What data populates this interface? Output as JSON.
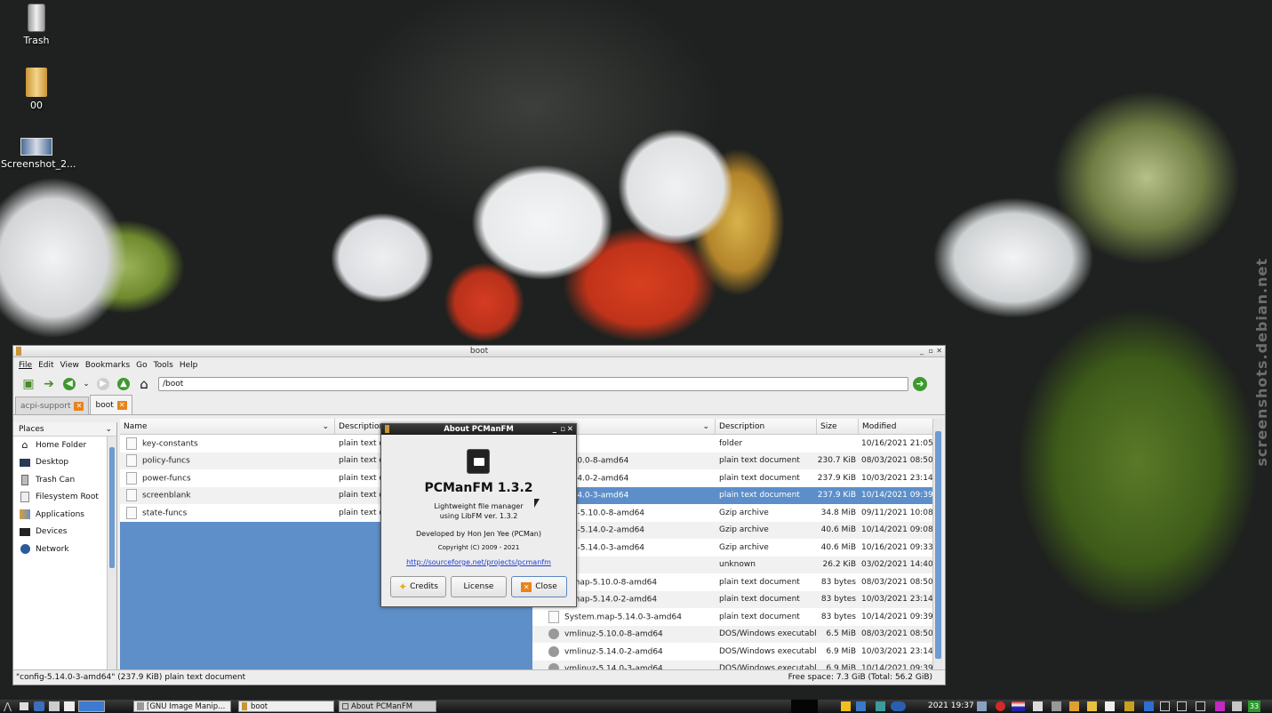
{
  "desktop": {
    "icons": [
      {
        "label": "Trash"
      },
      {
        "label": "00"
      },
      {
        "label": "Screenshot_2..."
      }
    ],
    "watermark": "screenshots.debian.net"
  },
  "window": {
    "title": "boot",
    "menu": [
      "File",
      "Edit",
      "View",
      "Bookmarks",
      "Go",
      "Tools",
      "Help"
    ],
    "path": "/boot",
    "tabs": [
      {
        "label": "acpi-support"
      },
      {
        "label": "boot"
      }
    ],
    "places": {
      "header": "Places",
      "items": [
        "Home Folder",
        "Desktop",
        "Trash Can",
        "Filesystem Root",
        "Applications",
        "Devices",
        "Network"
      ]
    },
    "left_pane": {
      "columns": [
        "Name",
        "Description"
      ],
      "rows": [
        {
          "name": "key-constants",
          "desc": "plain text d"
        },
        {
          "name": "policy-funcs",
          "desc": "plain text d"
        },
        {
          "name": "power-funcs",
          "desc": "plain text d"
        },
        {
          "name": "screenblank",
          "desc": "plain text d"
        },
        {
          "name": "state-funcs",
          "desc": "plain text d"
        }
      ]
    },
    "right_pane": {
      "columns": [
        "Description",
        "Size",
        "Modified"
      ],
      "rows": [
        {
          "name": "",
          "desc": "folder",
          "size": "",
          "mod": "10/16/2021 21:05"
        },
        {
          "name": "5.10.0-8-amd64",
          "desc": "plain text document",
          "size": "230.7 KiB",
          "mod": "08/03/2021 08:50"
        },
        {
          "name": "5.14.0-2-amd64",
          "desc": "plain text document",
          "size": "237.9 KiB",
          "mod": "10/03/2021 23:14"
        },
        {
          "name": "5.14.0-3-amd64",
          "desc": "plain text document",
          "size": "237.9 KiB",
          "mod": "10/14/2021 09:39"
        },
        {
          "name": "mg-5.10.0-8-amd64",
          "desc": "Gzip archive",
          "size": "34.8 MiB",
          "mod": "09/11/2021 10:08"
        },
        {
          "name": "mg-5.14.0-2-amd64",
          "desc": "Gzip archive",
          "size": "40.6 MiB",
          "mod": "10/14/2021 09:08"
        },
        {
          "name": "mg-5.14.0-3-amd64",
          "desc": "Gzip archive",
          "size": "40.6 MiB",
          "mod": "10/16/2021 09:33"
        },
        {
          "name": "isk",
          "desc": "unknown",
          "size": "26.2 KiB",
          "mod": "03/02/2021 14:40"
        },
        {
          "name": "n.map-5.10.0-8-amd64",
          "desc": "plain text document",
          "size": "83 bytes",
          "mod": "08/03/2021 08:50"
        },
        {
          "name": "n.map-5.14.0-2-amd64",
          "desc": "plain text document",
          "size": "83 bytes",
          "mod": "10/03/2021 23:14"
        },
        {
          "name": "System.map-5.14.0-3-amd64",
          "desc": "plain text document",
          "size": "83 bytes",
          "mod": "10/14/2021 09:39"
        },
        {
          "name": "vmlinuz-5.10.0-8-amd64",
          "desc": "DOS/Windows executable",
          "size": "6.5 MiB",
          "mod": "08/03/2021 08:50"
        },
        {
          "name": "vmlinuz-5.14.0-2-amd64",
          "desc": "DOS/Windows executable",
          "size": "6.9 MiB",
          "mod": "10/03/2021 23:14"
        },
        {
          "name": "vmlinuz-5.14.0-3-amd64",
          "desc": "DOS/Windows executable",
          "size": "6.9 MiB",
          "mod": "10/14/2021 09:39"
        }
      ]
    },
    "status_left": "\"config-5.14.0-3-amd64\" (237.9 KiB) plain text document",
    "status_right": "Free space: 7.3 GiB (Total: 56.2 GiB)"
  },
  "about": {
    "title": "About PCManFM",
    "app_name": "PCManFM 1.3.2",
    "desc_line1": "Lightweight file manager",
    "desc_line2": "using LibFM ver. 1.3.2",
    "developer": "Developed by Hon Jen Yee (PCMan)",
    "copyright": "Copyright (C) 2009 - 2021",
    "link": "http://sourceforge.net/projects/pcmanfm",
    "btn_credits": "Credits",
    "btn_license": "License",
    "btn_close": "Close"
  },
  "taskbar": {
    "tasks": [
      "[GNU Image Manip...",
      "boot",
      "About PCManFM"
    ],
    "clock": "2021 19:37",
    "workspace": "33"
  },
  "colors": {
    "selection": "#5c8ec9",
    "accent_orange": "#e8831a"
  }
}
